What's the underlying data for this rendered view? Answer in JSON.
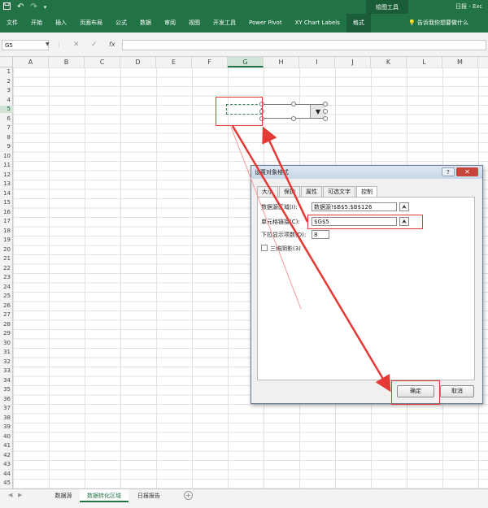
{
  "title_bar": {
    "qat": [
      "save-icon",
      "undo-icon",
      "redo-icon",
      "customize-icon"
    ],
    "context_tab_title": "绘图工具",
    "window_title": "日报 - Exc"
  },
  "ribbon": {
    "tabs": [
      "文件",
      "开始",
      "插入",
      "页面布局",
      "公式",
      "数据",
      "审阅",
      "视图",
      "开发工具",
      "Power Pivot",
      "XY Chart Labels",
      "格式"
    ],
    "active_tab": "格式",
    "tell_me": "告诉我你想要做什么"
  },
  "formula_bar": {
    "name_box": "G5",
    "cancel": "✕",
    "enter": "✓",
    "fx": "fx",
    "formula": ""
  },
  "grid": {
    "columns": [
      "A",
      "B",
      "C",
      "D",
      "E",
      "F",
      "G",
      "H",
      "I",
      "J",
      "K",
      "L",
      "M"
    ],
    "rows": [
      "1",
      "2",
      "3",
      "4",
      "5",
      "6",
      "7",
      "8",
      "9",
      "10",
      "11",
      "12",
      "13",
      "14",
      "15",
      "16",
      "17",
      "18",
      "19",
      "20",
      "21",
      "22",
      "23",
      "24",
      "25",
      "26",
      "27",
      "28",
      "29",
      "30",
      "31",
      "32",
      "33",
      "34",
      "35",
      "36",
      "37",
      "38",
      "39",
      "40",
      "41",
      "42",
      "43",
      "44",
      "45"
    ],
    "selected_cell": "G5"
  },
  "dialog": {
    "title": "设置对象格式",
    "help": "?",
    "close": "✕",
    "tabs": [
      "大小",
      "保护",
      "属性",
      "可选文字",
      "控制"
    ],
    "active_tab": "控制",
    "input_range_label": "数据源区域(I):",
    "input_range_value": "数据源!$B$5:$B$126",
    "cell_link_label": "单元格链接(C):",
    "cell_link_value": "$G$5",
    "dropdown_lines_label": "下拉显示项数(D):",
    "dropdown_lines_value": "8",
    "shading_3d_label": "三维阴影(3)",
    "ok": "确定",
    "cancel": "取消"
  },
  "sheet_tabs": {
    "tabs": [
      "数据源",
      "数据转化区域",
      "日报报告"
    ],
    "active": "数据转化区域",
    "add": "+"
  },
  "colors": {
    "excel_green": "#217346",
    "annotation_red": "#e53935"
  }
}
